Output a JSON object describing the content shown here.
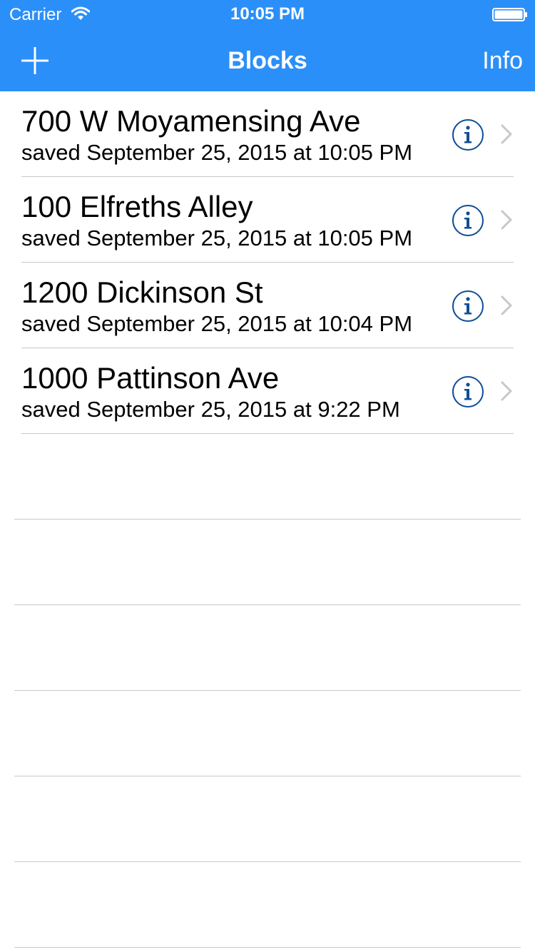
{
  "status_bar": {
    "carrier": "Carrier",
    "time": "10:05 PM",
    "wifi_icon": "wifi-icon",
    "battery_icon": "battery-icon"
  },
  "nav_bar": {
    "title": "Blocks",
    "add_icon": "plus-icon",
    "info_label": "Info"
  },
  "colors": {
    "nav_background": "#2b8ff9",
    "info_icon": "#0f4e96",
    "chevron": "#c7c7cc",
    "separator": "#c8c7cc"
  },
  "blocks": [
    {
      "title": "700 W Moyamensing Ave",
      "subtitle": "saved September 25, 2015 at 10:05 PM"
    },
    {
      "title": "100 Elfreths Alley",
      "subtitle": "saved September 25, 2015 at 10:05 PM"
    },
    {
      "title": "1200 Dickinson St",
      "subtitle": "saved September 25, 2015 at 10:04 PM"
    },
    {
      "title": "1000 Pattinson Ave",
      "subtitle": "saved September 25, 2015 at 9:22 PM"
    }
  ]
}
